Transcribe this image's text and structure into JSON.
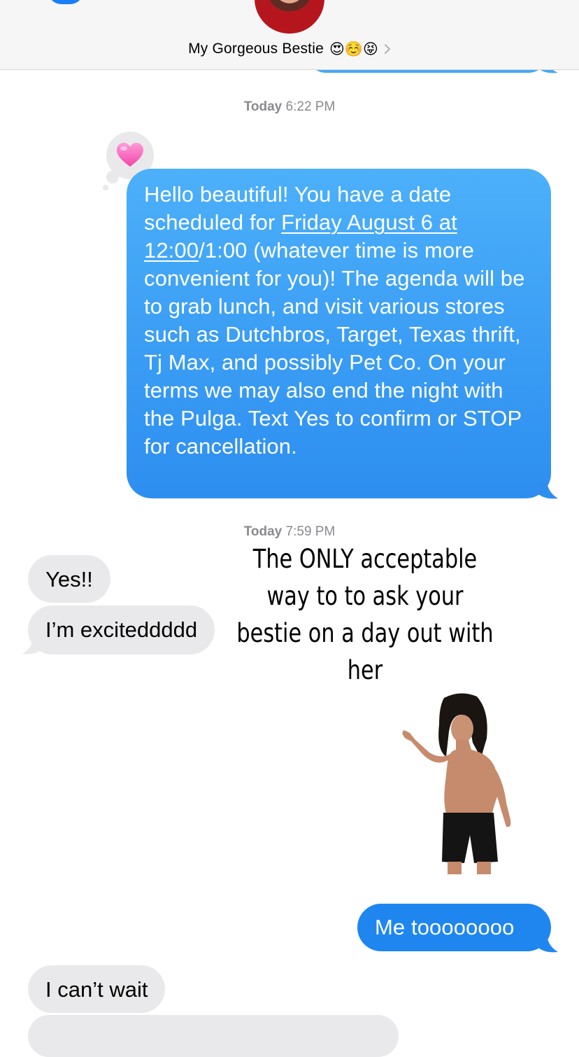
{
  "header": {
    "contact_name": "My Gorgeous Bestie",
    "contact_emojis": "😍☺️😝",
    "icons": [
      "back-chevron-icon",
      "contact-avatar",
      "video-call-icon",
      "chevron-right-icon"
    ]
  },
  "thread": {
    "stamp1": {
      "day": "Today",
      "time": "6:22 PM"
    },
    "tapback_reaction": "💗",
    "sent_message": {
      "part1": "Hello beautiful! You have a date scheduled for ",
      "link1": "Friday August 6 at",
      "link2": "12:00",
      "part2": "/1:00 (whatever time is more convenient for you)! The agenda will be to grab lunch, and visit various stores such as Dutchbros, Target, Texas thrift, Tj Max, and possibly Pet Co. On your terms we may also end the night with the Pulga. Text Yes to confirm or STOP for cancellation."
    },
    "stamp2": {
      "day": "Today",
      "time": "7:59 PM"
    },
    "received_1": "Yes!!",
    "received_2": "I’m exciteddddd",
    "overlay_caption": "The ONLY acceptable way to to ask your bestie on a day out with her",
    "sent_reply": "Me toooooooo",
    "received_3": "I can’t wait"
  },
  "colors": {
    "sent_bubble": "#3a9df4",
    "received_bubble": "#e9e9eb",
    "header_bg": "#f6f6f6",
    "timestamp": "#8a8a8e"
  }
}
